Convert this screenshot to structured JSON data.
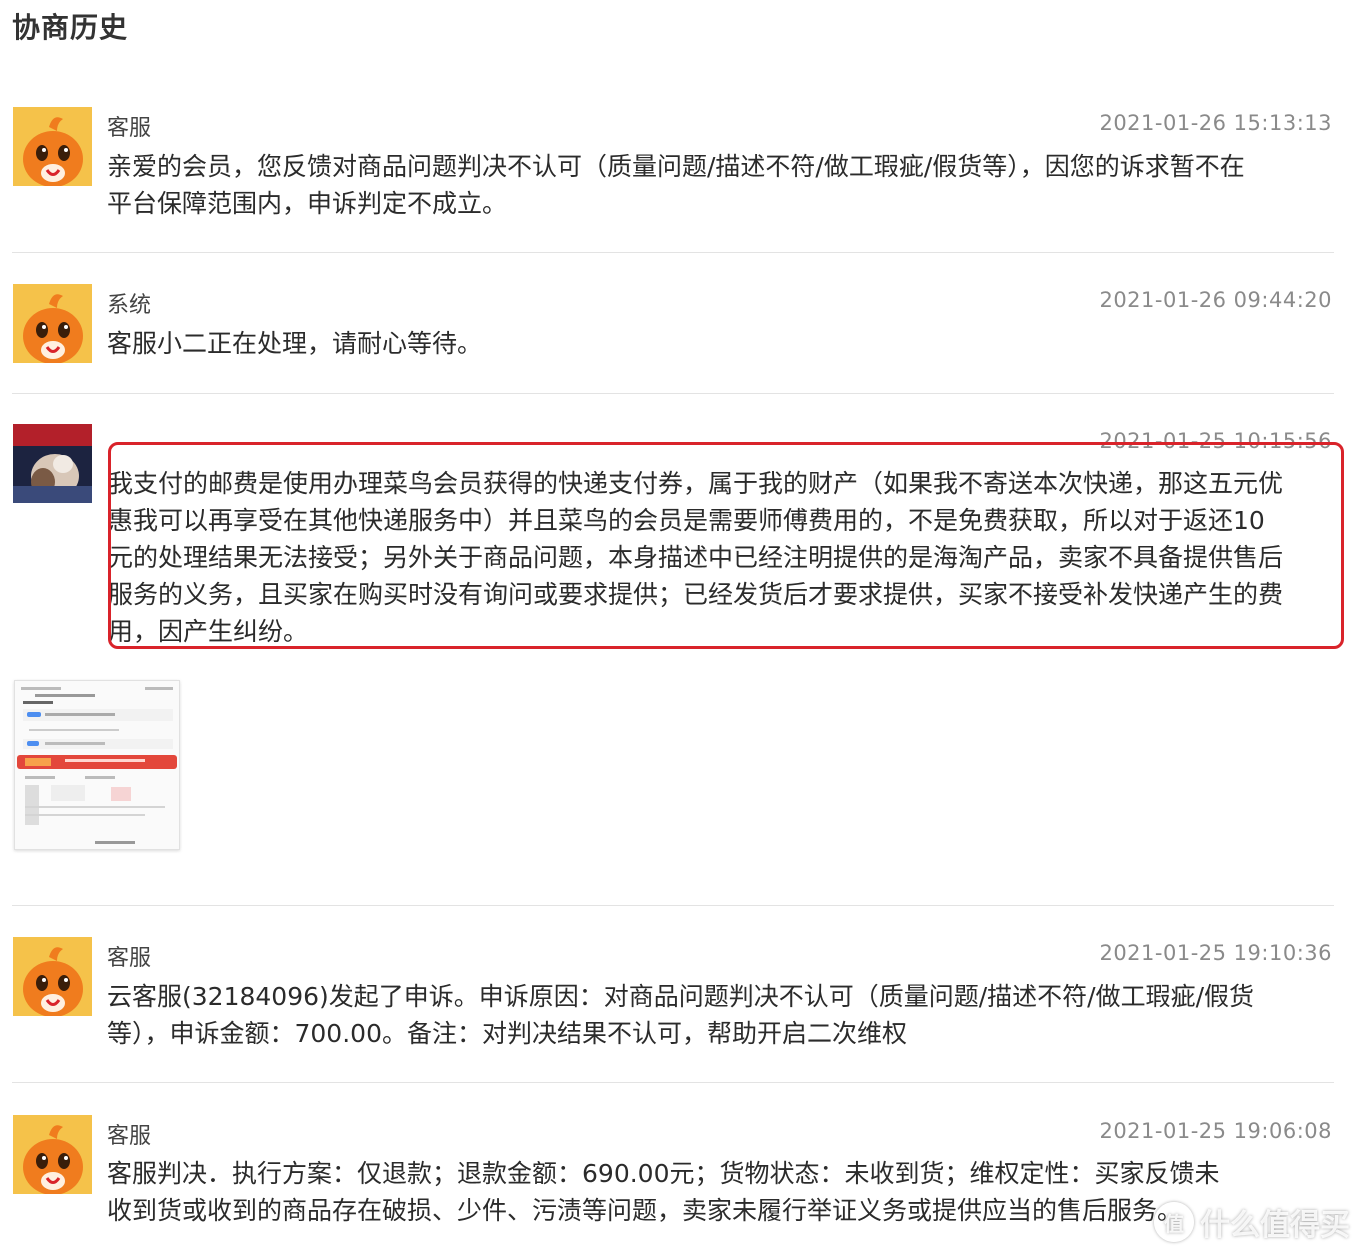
{
  "page": {
    "title": "协商历史"
  },
  "entries": [
    {
      "author": "客服",
      "time": "2021-01-26 15:13:13",
      "lines": [
        "亲爱的会员，您反馈对商品问题判决不认可（质量问题/描述不符/做工瑕疵/假货等），因您的诉求暂不在",
        "平台保障范围内，申诉判定不成立。"
      ]
    },
    {
      "author": "系统",
      "time": "2021-01-26 09:44:20",
      "lines": [
        "客服小二正在处理，请耐心等待。"
      ]
    },
    {
      "author": "",
      "time": "2021-01-25 10:15:56",
      "lines": [
        "我支付的邮费是使用办理菜鸟会员获得的快递支付券，属于我的财产（如果我不寄送本次快递，那这五元优",
        "惠我可以再享受在其他快递服务中）并且菜鸟的会员是需要师傅费用的，不是免费获取，所以对于返还10",
        "元的处理结果无法接受；另外关于商品问题，本身描述中已经注明提供的是海淘产品，卖家不具备提供售后",
        "服务的义务，且买家在购买时没有询问或要求提供；已经发货后才要求提供，买家不接受补发快递产生的费",
        "用，因产生纠纷。"
      ]
    },
    {
      "author": "客服",
      "time": "2021-01-25 19:10:36",
      "lines": [
        "云客服(32184096)发起了申诉。申诉原因：对商品问题判决不认可（质量问题/描述不符/做工瑕疵/假货",
        "等），申诉金额：700.00。备注：对判决结果不认可，帮助开启二次维权"
      ]
    },
    {
      "author": "客服",
      "time": "2021-01-25 19:06:08",
      "lines": [
        "客服判决．执行方案：仅退款；退款金额：690.00元；货物状态：未收到货；维权定性：买家反馈未",
        "收到货或收到的商品存在破损、少件、污渍等问题，卖家未履行举证义务或提供应当的售后服务。"
      ]
    }
  ],
  "watermark": {
    "text": "什么值得买",
    "logo": "值"
  },
  "colors": {
    "highlight": "#d9232a",
    "mascot": "#f3b221",
    "timestamp": "#8a8a8a"
  },
  "icons": {
    "mascot": "taobao-mascot-avatar",
    "user": "user-photo-avatar"
  }
}
